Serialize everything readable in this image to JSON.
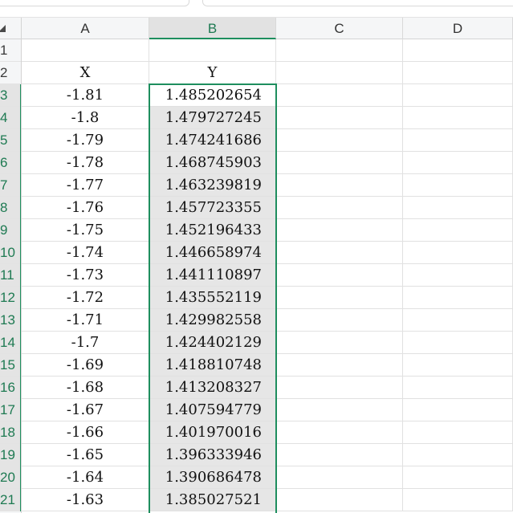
{
  "columns": [
    "A",
    "B",
    "C",
    "D"
  ],
  "selected_column": "B",
  "rows": [
    {
      "num": "1",
      "a": "",
      "b": ""
    },
    {
      "num": "2",
      "a": "X",
      "b": "Y"
    },
    {
      "num": "3",
      "a": "-1.81",
      "b": "1.485202654"
    },
    {
      "num": "4",
      "a": "-1.8",
      "b": "1.479727245"
    },
    {
      "num": "5",
      "a": "-1.79",
      "b": "1.474241686"
    },
    {
      "num": "6",
      "a": "-1.78",
      "b": "1.468745903"
    },
    {
      "num": "7",
      "a": "-1.77",
      "b": "1.463239819"
    },
    {
      "num": "8",
      "a": "-1.76",
      "b": "1.457723355"
    },
    {
      "num": "9",
      "a": "-1.75",
      "b": "1.452196433"
    },
    {
      "num": "10",
      "a": "-1.74",
      "b": "1.446658974"
    },
    {
      "num": "11",
      "a": "-1.73",
      "b": "1.441110897"
    },
    {
      "num": "12",
      "a": "-1.72",
      "b": "1.435552119"
    },
    {
      "num": "13",
      "a": "-1.71",
      "b": "1.429982558"
    },
    {
      "num": "14",
      "a": "-1.7",
      "b": "1.424402129"
    },
    {
      "num": "15",
      "a": "-1.69",
      "b": "1.418810748"
    },
    {
      "num": "16",
      "a": "-1.68",
      "b": "1.413208327"
    },
    {
      "num": "17",
      "a": "-1.67",
      "b": "1.407594779"
    },
    {
      "num": "18",
      "a": "-1.66",
      "b": "1.401970016"
    },
    {
      "num": "19",
      "a": "-1.65",
      "b": "1.396333946"
    },
    {
      "num": "20",
      "a": "-1.64",
      "b": "1.390686478"
    },
    {
      "num": "21",
      "a": "-1.63",
      "b": "1.385027521"
    }
  ],
  "selection": {
    "first_row": 3,
    "last_row": 21,
    "active_row": 3
  },
  "colors": {
    "accent": "#1e8e5e",
    "selected_fill": "#e6e6e6"
  }
}
